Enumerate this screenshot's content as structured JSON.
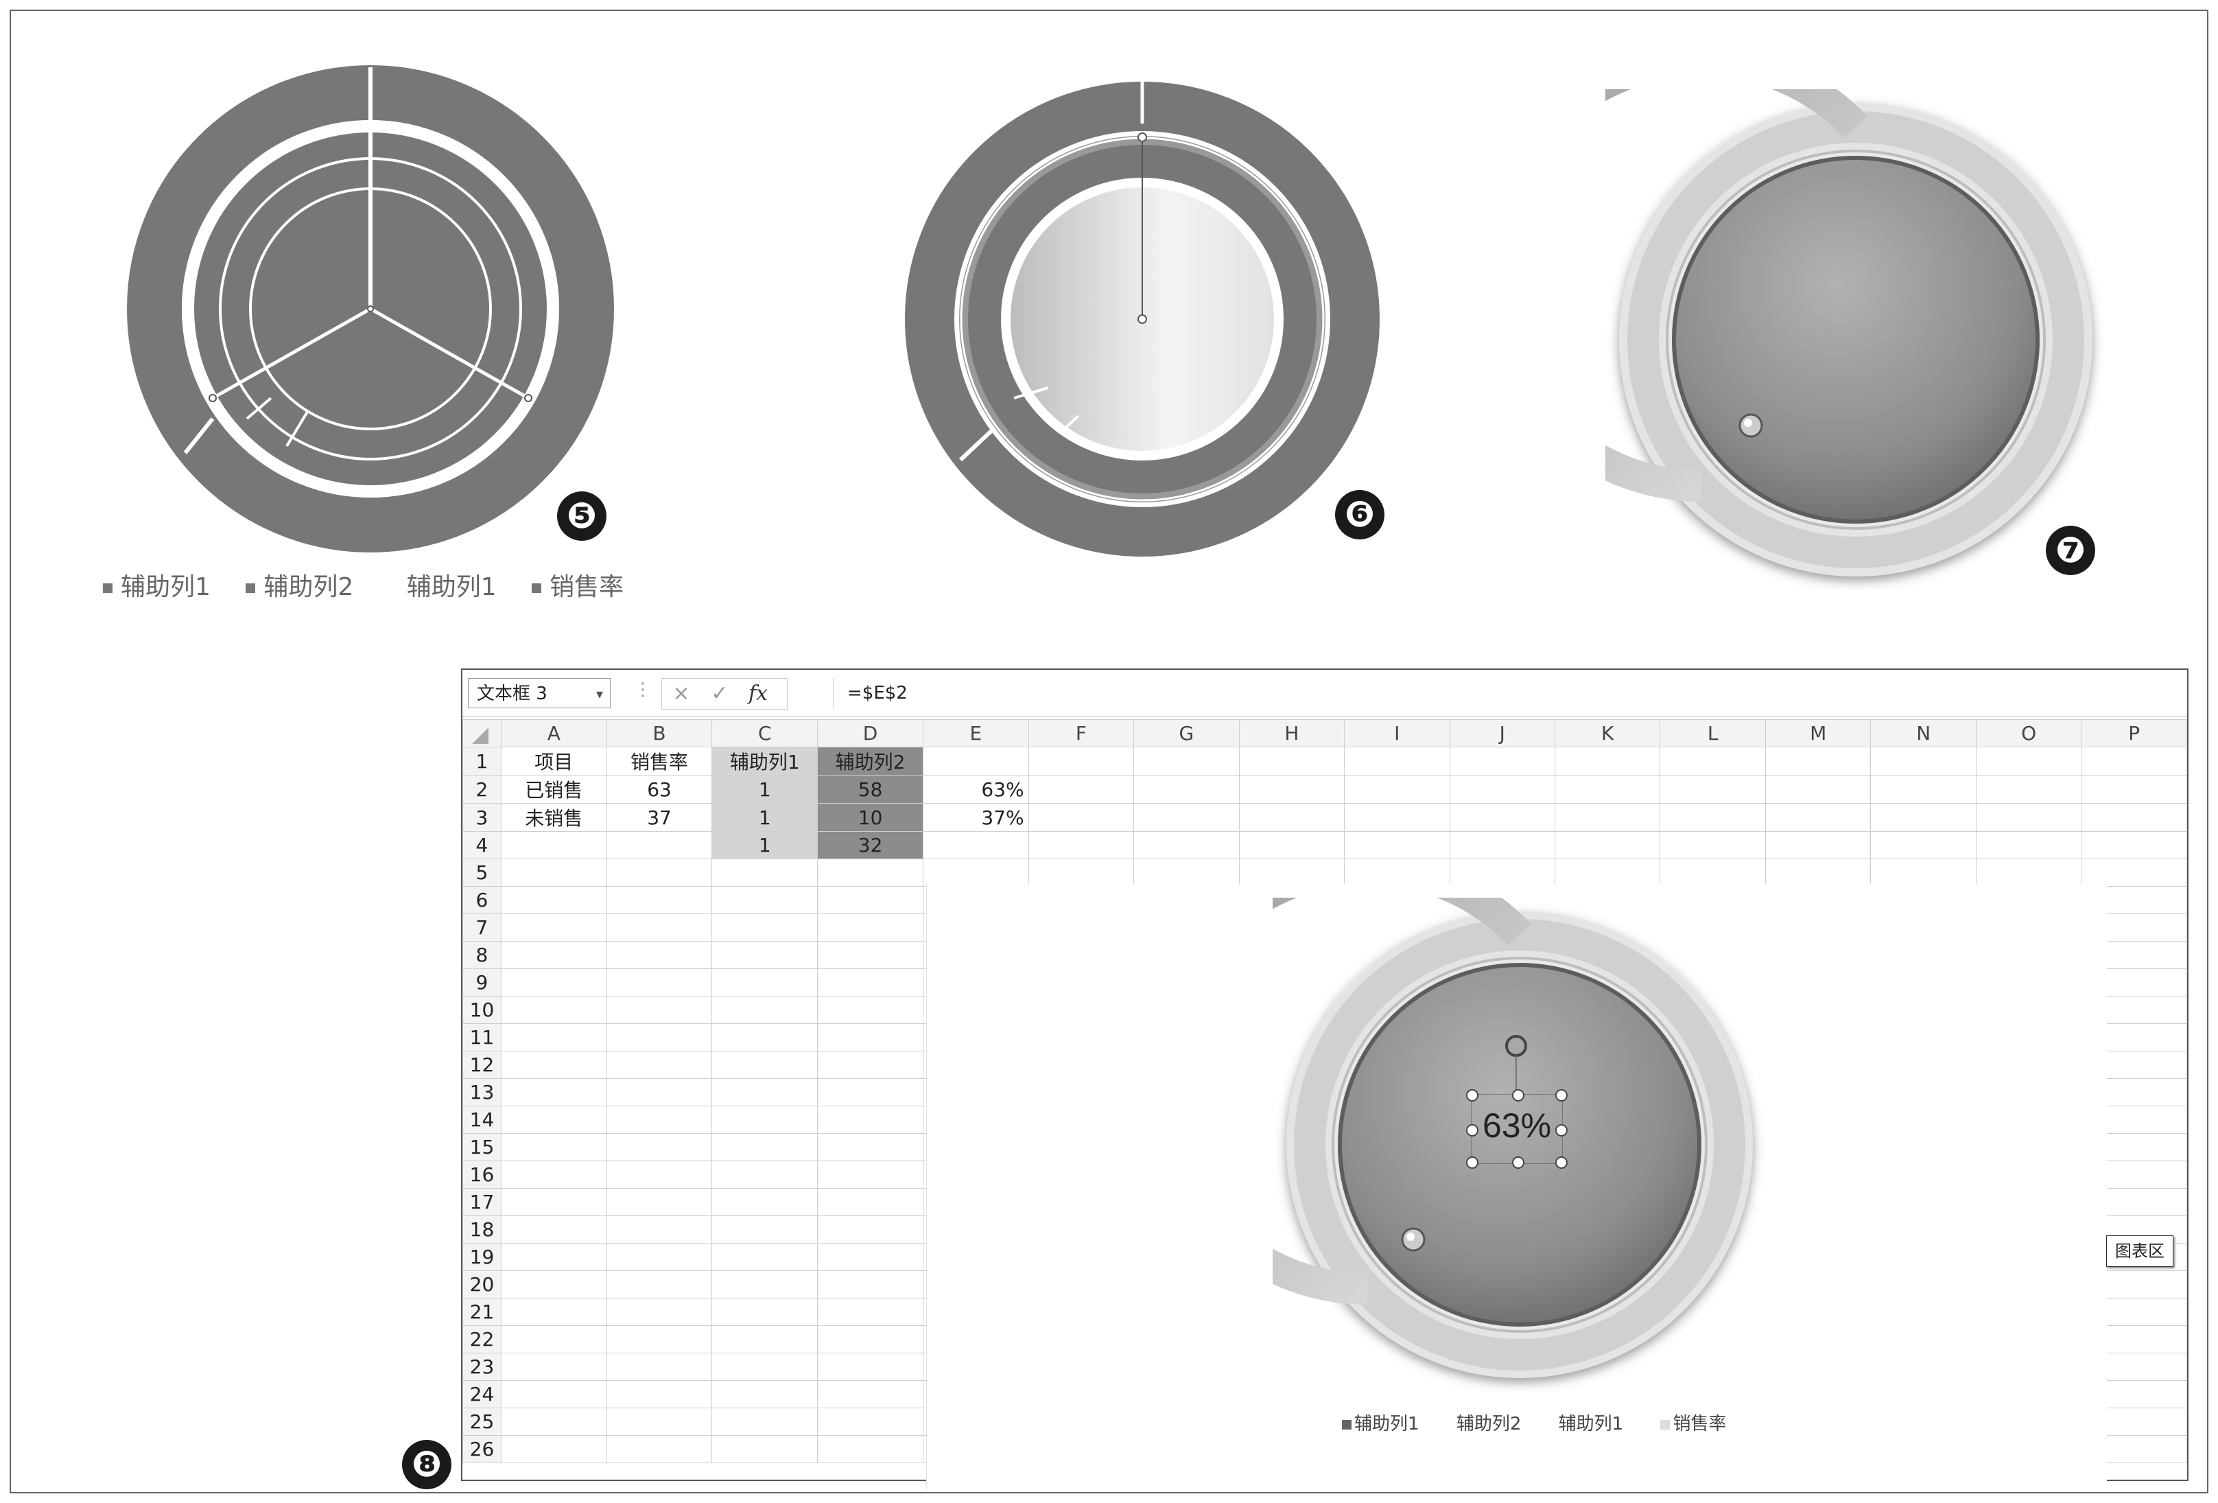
{
  "step_badges": {
    "five": "❺",
    "six": "❻",
    "seven": "❼",
    "eight": "❽"
  },
  "legend_top": {
    "items": [
      {
        "label": "辅助列1",
        "marker": true
      },
      {
        "label": "辅助列2",
        "marker": true
      },
      {
        "label": "辅助列1",
        "marker": false
      },
      {
        "label": "销售率",
        "marker": true
      }
    ]
  },
  "excel": {
    "name_box": "文本框 3",
    "formula": "=$E$2",
    "buttons": {
      "cancel": "×",
      "enter": "✓",
      "fx": "fx"
    },
    "columns": [
      "A",
      "B",
      "C",
      "D",
      "E",
      "F",
      "G",
      "H",
      "I",
      "J",
      "K",
      "L",
      "M",
      "N",
      "O",
      "P"
    ],
    "rows": [
      [
        "项目",
        "销售率",
        "辅助列1",
        "辅助列2",
        "",
        ""
      ],
      [
        "已销售",
        "63",
        "1",
        "58",
        "63%",
        ""
      ],
      [
        "未销售",
        "37",
        "1",
        "10",
        "37%",
        ""
      ],
      [
        "",
        "",
        "1",
        "32",
        "",
        ""
      ]
    ],
    "row_numbers": [
      "1",
      "2",
      "3",
      "4",
      "5",
      "6",
      "7",
      "8",
      "9",
      "10",
      "11",
      "12",
      "13",
      "14",
      "15",
      "16",
      "17",
      "18",
      "19",
      "20",
      "21",
      "22",
      "23",
      "24",
      "25",
      "26"
    ]
  },
  "chart": {
    "center_label": "63%",
    "legend": [
      "辅助列1",
      "辅助列2",
      "辅助列1",
      "销售率"
    ],
    "tooltip": "图表区",
    "sold_pct": 63
  },
  "colors": {
    "dark_gray": "#777777",
    "mid_gray": "#8a8a8a",
    "light_gray": "#d6d6d6"
  }
}
